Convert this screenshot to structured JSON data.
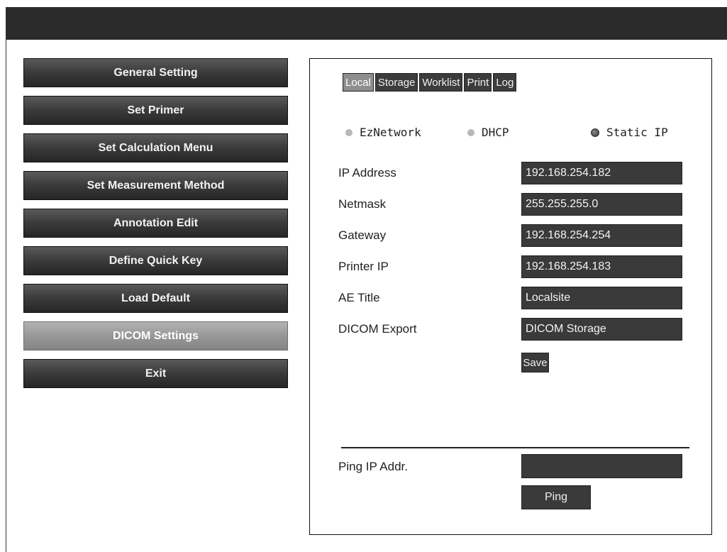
{
  "menu": {
    "items": [
      {
        "label": "General Setting",
        "active": false
      },
      {
        "label": "Set Primer",
        "active": false
      },
      {
        "label": "Set Calculation Menu",
        "active": false
      },
      {
        "label": "Set Measurement Method",
        "active": false
      },
      {
        "label": "Annotation Edit",
        "active": false
      },
      {
        "label": "Define Quick Key",
        "active": false
      },
      {
        "label": "Load Default",
        "active": false
      },
      {
        "label": "DICOM Settings",
        "active": true
      },
      {
        "label": "Exit",
        "active": false
      }
    ]
  },
  "tabs": [
    {
      "label": "Local",
      "active": true
    },
    {
      "label": "Storage",
      "active": false
    },
    {
      "label": "Worklist",
      "active": false
    },
    {
      "label": "Print",
      "active": false
    },
    {
      "label": "Log",
      "active": false
    }
  ],
  "network_mode": {
    "options": [
      {
        "label": "EzNetwork",
        "selected": false
      },
      {
        "label": "DHCP",
        "selected": false
      },
      {
        "label": "Static IP",
        "selected": true
      }
    ]
  },
  "fields": [
    {
      "label": "IP Address",
      "value": "192.168.254.182"
    },
    {
      "label": "Netmask",
      "value": "255.255.255.0"
    },
    {
      "label": "Gateway",
      "value": "192.168.254.254"
    },
    {
      "label": "Printer IP",
      "value": "192.168.254.183"
    },
    {
      "label": "AE Title",
      "value": "Localsite"
    },
    {
      "label": "DICOM Export",
      "value": "DICOM Storage"
    }
  ],
  "save_label": "Save",
  "ping": {
    "label": "Ping IP Addr.",
    "value": "",
    "button_label": "Ping"
  },
  "colors": {
    "titlebar": "#2b2b2b",
    "button_dark": "#3a3a3a",
    "button_active": "#979797"
  }
}
